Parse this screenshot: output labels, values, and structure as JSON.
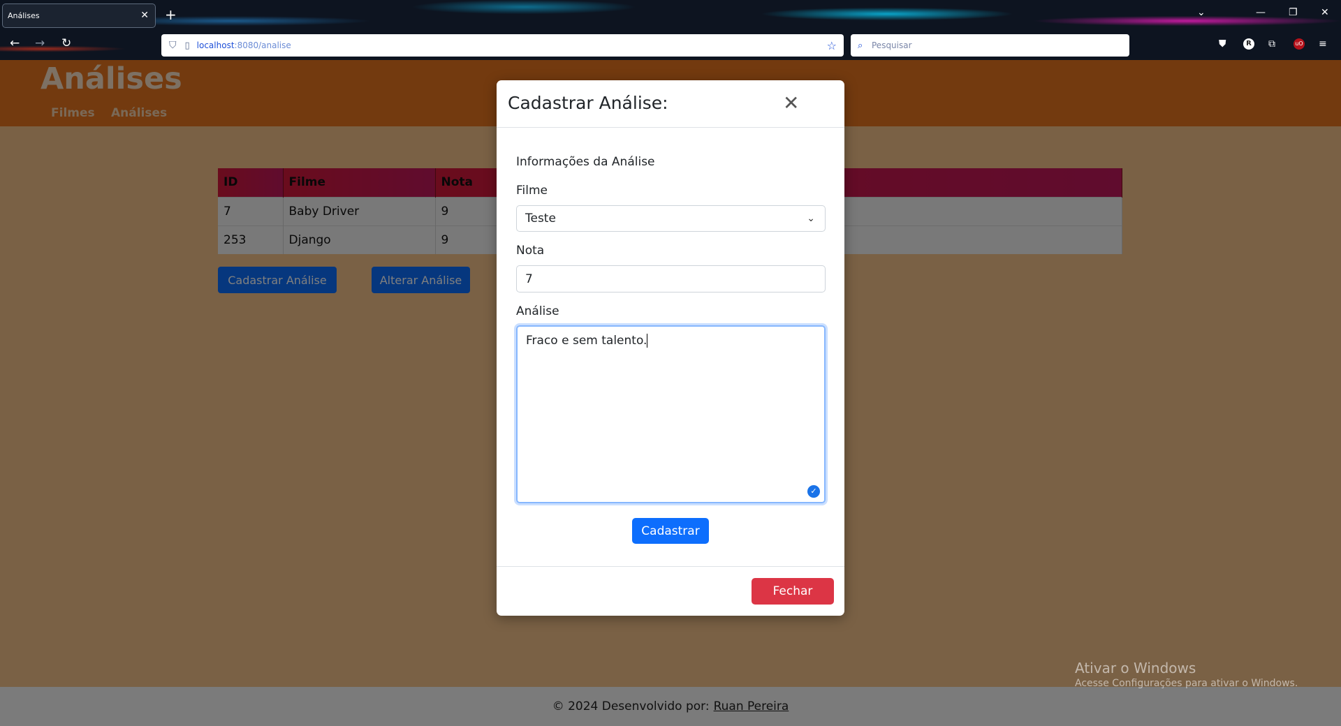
{
  "browser": {
    "tab_title": "Análises",
    "url_host": "localhost",
    "url_rest": ":8080/analise",
    "search_placeholder": "Pesquisar"
  },
  "site": {
    "title": "Análises",
    "nav": [
      "Filmes",
      "Análises"
    ]
  },
  "table": {
    "headers": [
      "ID",
      "Filme",
      "Nota"
    ],
    "rows": [
      [
        "7",
        "Baby Driver",
        "9"
      ],
      [
        "253",
        "Django",
        "9"
      ]
    ]
  },
  "page_buttons": {
    "cadastrar": "Cadastrar Análise",
    "alterar": "Alterar Análise"
  },
  "modal": {
    "title": "Cadastrar Análise:",
    "section": "Informações da Análise",
    "filme_label": "Filme",
    "filme_value": "Teste",
    "nota_label": "Nota",
    "nota_value": "7",
    "analise_label": "Análise",
    "analise_value": "Fraco e sem talento.",
    "submit": "Cadastrar",
    "close": "Fechar"
  },
  "footer": {
    "text": "© 2024 Desenvolvido por:",
    "author": "Ruan Pereira"
  },
  "watermark": {
    "title": "Ativar o Windows",
    "subtitle": "Acesse Configurações para ativar o Windows."
  },
  "colors": {
    "header": "#e7741f",
    "primary": "#0d6efd",
    "danger": "#dc3545",
    "table_header": "#d4183a"
  }
}
